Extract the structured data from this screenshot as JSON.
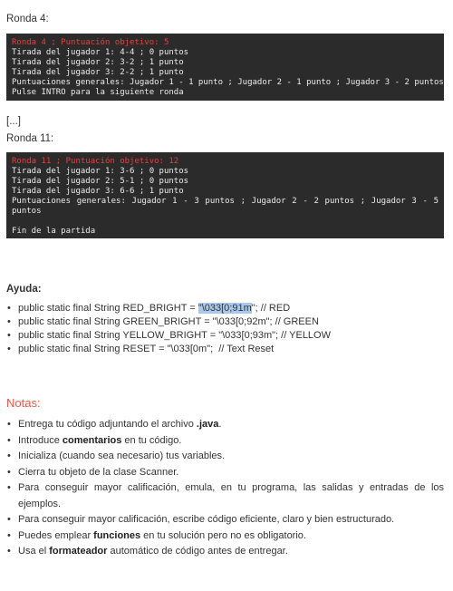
{
  "round4": {
    "label": "Ronda 4:",
    "header": "Ronda 4 ; Puntuación objetivo: 5",
    "lines": [
      "Tirada del jugador 1: 4-4 ; 0 puntos",
      "Tirada del jugador 2: 3-2 ; 1 punto",
      "Tirada del jugador 3: 2-2 ; 1 punto",
      "Puntuaciones generales: Jugador 1 - 1 punto ; Jugador 2 - 1 punto ; Jugador 3 - 2 puntos",
      "Pulse INTRO para la siguiente ronda"
    ]
  },
  "ellipsis": "[...]",
  "round11": {
    "label": "Ronda 11:",
    "header": "Ronda 11 ; Puntuación objetivo: 12",
    "lines": [
      "Tirada del jugador 1: 3-6 ; 0 puntos",
      "Tirada del jugador 2: 5-1 ; 0 puntos",
      "Tirada del jugador 3: 6-6 ; 1 punto"
    ],
    "scores": "Puntuaciones generales: Jugador 1 - 3 puntos ; Jugador 2 - 2 puntos ; Jugador 3 - 5 puntos",
    "end": "Fin de la partida"
  },
  "help": {
    "title": "Ayuda:",
    "items": [
      {
        "pre": "public static final String RED_BRIGHT = ",
        "hl": "\"\\033[0;91m",
        "post": "\"; // RED"
      },
      {
        "pre": "public static final String GREEN_BRIGHT = \"\\033[0;92m\"; // GREEN",
        "hl": "",
        "post": ""
      },
      {
        "pre": "public static final String YELLOW_BRIGHT = \"\\033[0;93m\"; // YELLOW",
        "hl": "",
        "post": ""
      },
      {
        "pre": "public static final String RESET = \"\\033[0m\";  // Text Reset",
        "hl": "",
        "post": ""
      }
    ]
  },
  "notes": {
    "title": "Notas:",
    "items": [
      {
        "a": "Entrega tu código adjuntando el archivo ",
        "b": ".java",
        "c": "."
      },
      {
        "a": "Introduce ",
        "b": "comentarios",
        "c": " en tu código."
      },
      {
        "a": "Inicializa (cuando sea necesario) tus variables.",
        "b": "",
        "c": ""
      },
      {
        "a": "Cierra tu objeto de la clase Scanner.",
        "b": "",
        "c": ""
      },
      {
        "a": "Para conseguir mayor calificación, emula, en tu programa, las salidas y entradas de los ejemplos.",
        "b": "",
        "c": ""
      },
      {
        "a": "Para conseguir mayor calificación, escribe código eficiente, claro y bien estructurado.",
        "b": "",
        "c": ""
      },
      {
        "a": "Puedes emplear ",
        "b": "funciones",
        "c": " en tu solución pero no es obligatorio."
      },
      {
        "a": "Usa el ",
        "b": "formateador",
        "c": " automático de código antes de entregar."
      }
    ]
  },
  "colors": {
    "console_bg": "#2b2b2b",
    "console_fg": "#ececec",
    "console_red": "#e8403a",
    "notes_title": "#e55a45",
    "highlight": "#a9c9ec"
  }
}
